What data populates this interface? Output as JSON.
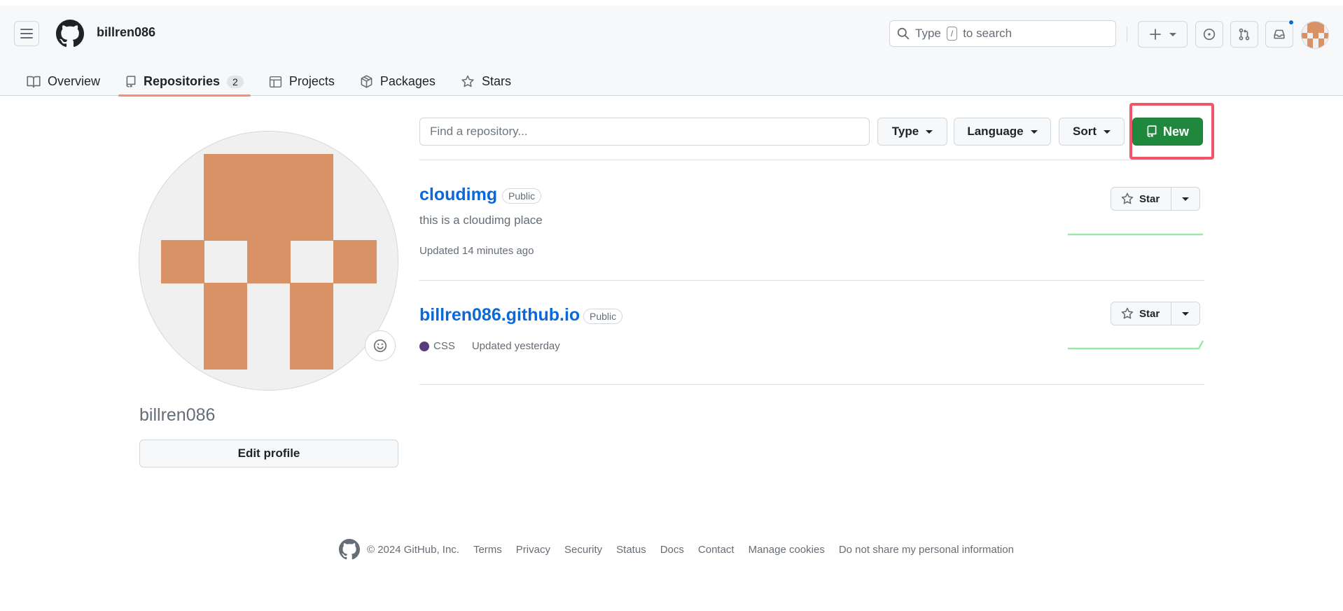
{
  "header": {
    "username": "billren086",
    "search_text": "Type",
    "search_key": "/",
    "search_suffix": "to search"
  },
  "tabs": [
    {
      "label": "Overview",
      "icon": "book-icon"
    },
    {
      "label": "Repositories",
      "icon": "repo-icon",
      "count": "2"
    },
    {
      "label": "Projects",
      "icon": "table-icon"
    },
    {
      "label": "Packages",
      "icon": "package-icon"
    },
    {
      "label": "Stars",
      "icon": "star-icon"
    }
  ],
  "profile": {
    "name": "billren086",
    "edit_label": "Edit profile",
    "avatar_color": "#d99265"
  },
  "controls": {
    "find_placeholder": "Find a repository...",
    "type_label": "Type",
    "language_label": "Language",
    "sort_label": "Sort",
    "new_label": "New",
    "new_color": "#1f883d",
    "highlight_color": "#f0556a"
  },
  "repos": [
    {
      "name": "cloudimg",
      "visibility": "Public",
      "description": "this is a cloudimg place",
      "updated": "Updated 14 minutes ago",
      "star_label": "Star"
    },
    {
      "name": "billren086.github.io",
      "visibility": "Public",
      "language": "CSS",
      "language_color": "#563d7c",
      "updated": "Updated yesterday",
      "star_label": "Star"
    }
  ],
  "footer": {
    "copyright": "© 2024 GitHub, Inc.",
    "links": [
      "Terms",
      "Privacy",
      "Security",
      "Status",
      "Docs",
      "Contact",
      "Manage cookies",
      "Do not share my personal information"
    ]
  }
}
